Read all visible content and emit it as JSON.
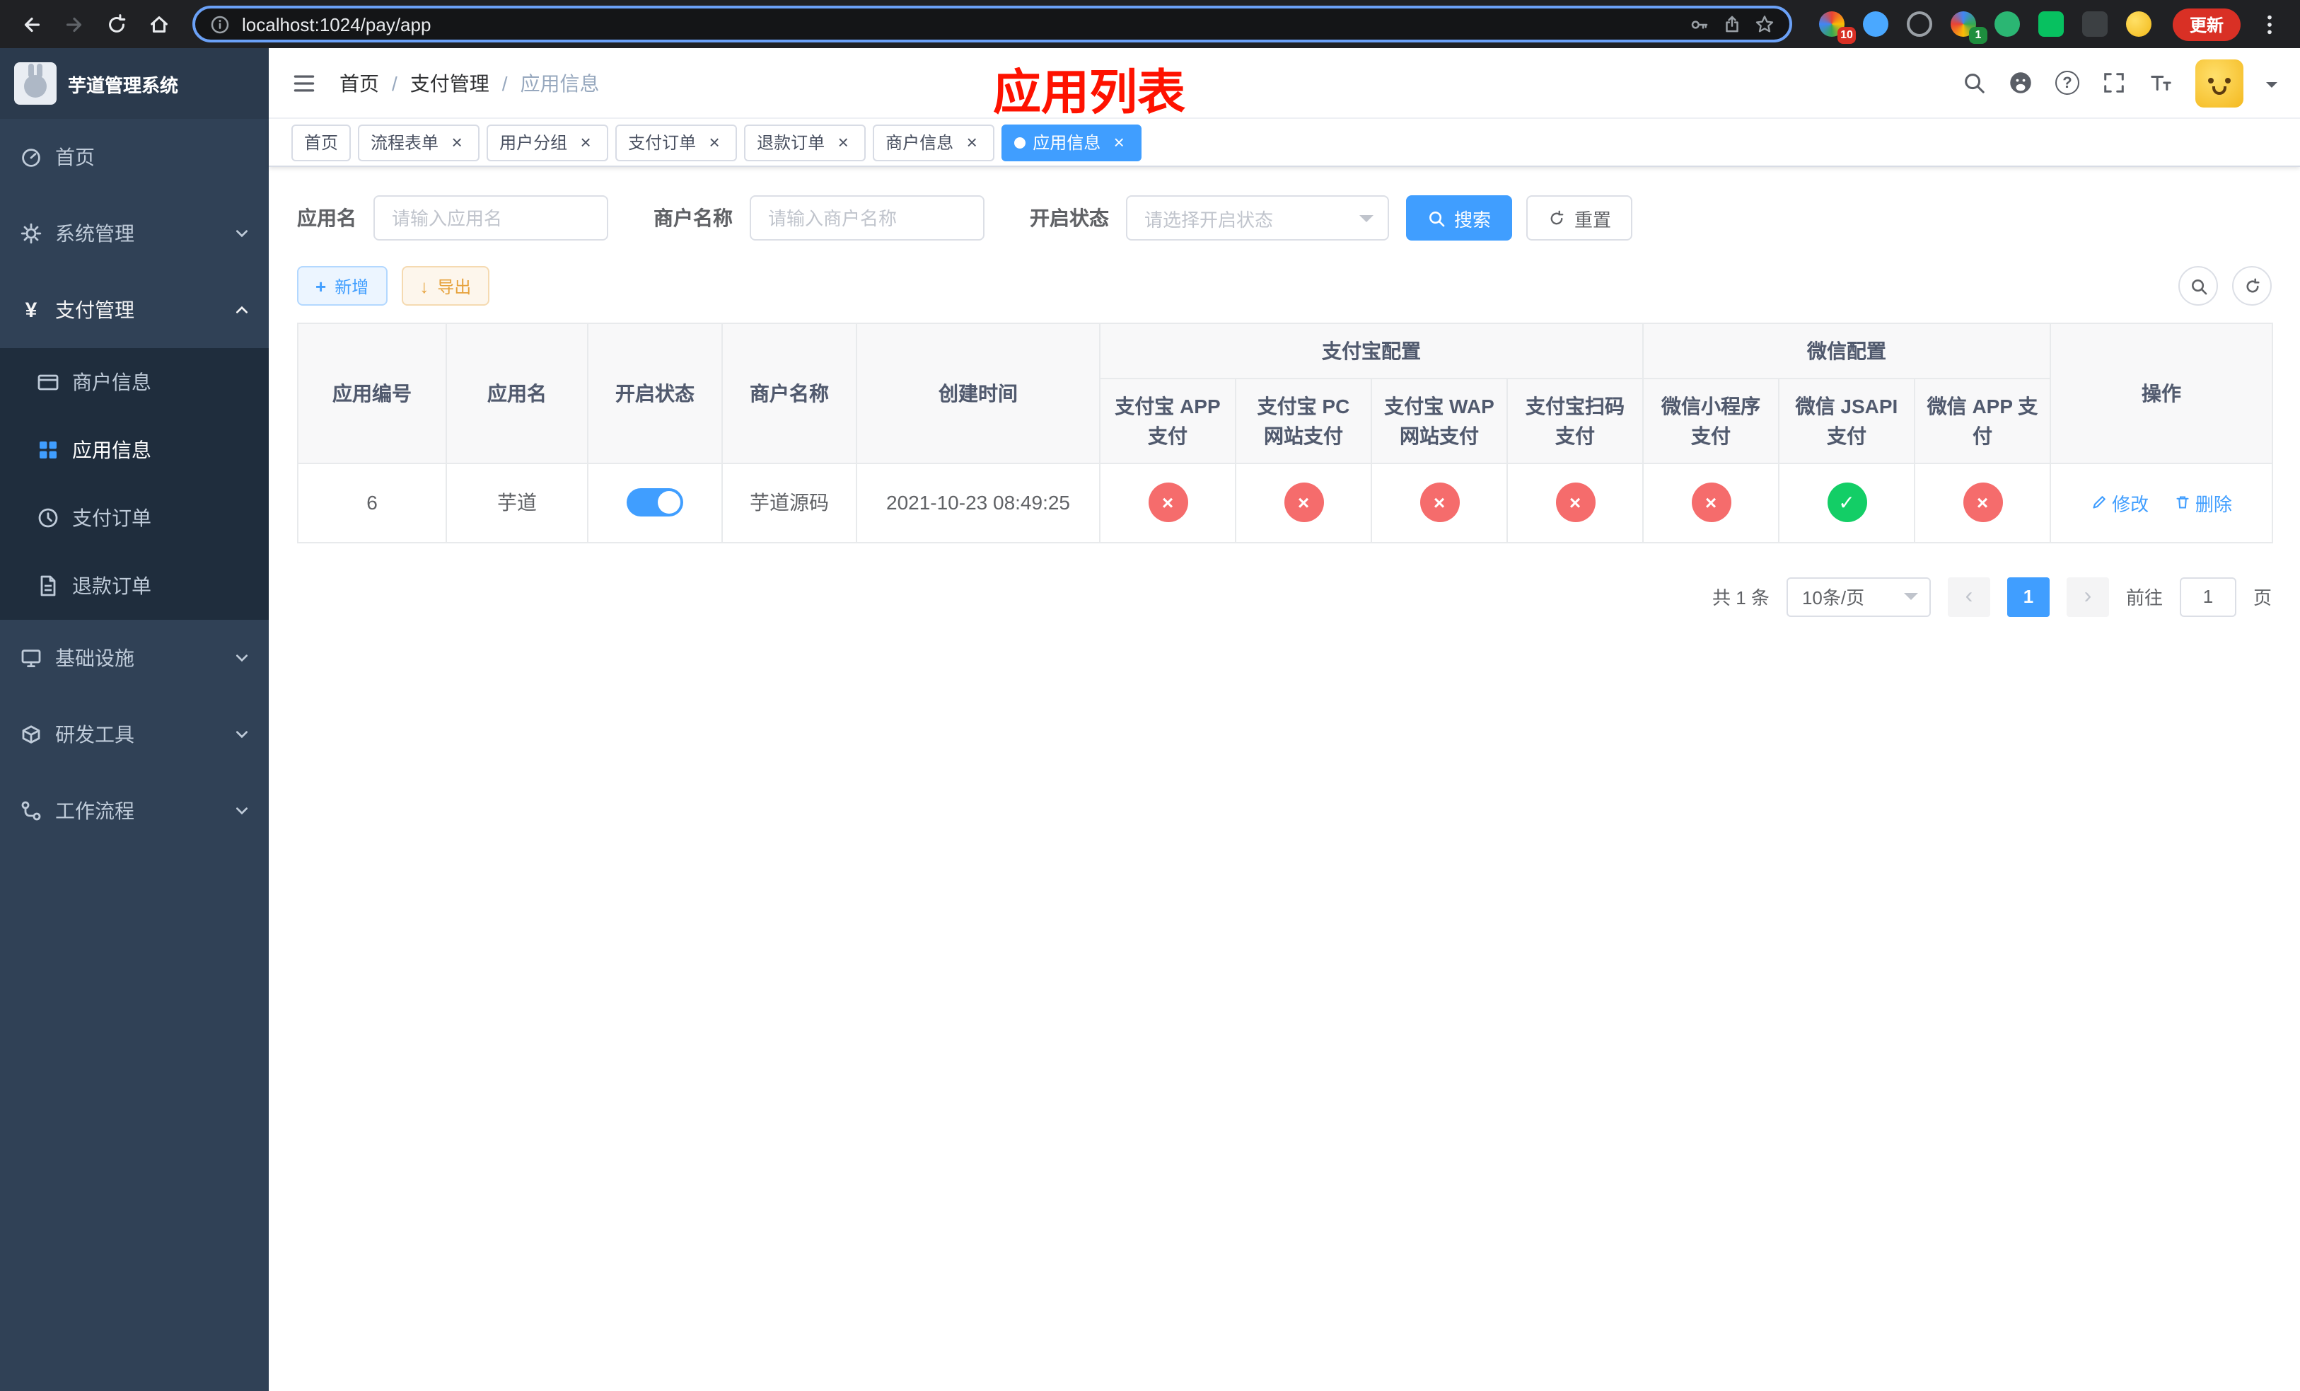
{
  "browser": {
    "url": "localhost:1024/pay/app",
    "update_label": "更新",
    "ext_badge_a": "10",
    "ext_badge_b": "1"
  },
  "icons": {
    "close": "×",
    "plus": "+",
    "check": "✓",
    "cross": "×",
    "yen": "¥",
    "help": "?",
    "prev": "‹",
    "next": "›",
    "download": "↓"
  },
  "sidebar": {
    "title": "芋道管理系统",
    "items": [
      {
        "label": "首页"
      },
      {
        "label": "系统管理"
      },
      {
        "label": "支付管理",
        "children": [
          {
            "label": "商户信息"
          },
          {
            "label": "应用信息"
          },
          {
            "label": "支付订单"
          },
          {
            "label": "退款订单"
          }
        ]
      },
      {
        "label": "基础设施"
      },
      {
        "label": "研发工具"
      },
      {
        "label": "工作流程"
      }
    ]
  },
  "navbar": {
    "breadcrumb": [
      "首页",
      "支付管理",
      "应用信息"
    ],
    "separator": "/"
  },
  "annotation": "应用列表",
  "tabs": [
    {
      "label": "首页"
    },
    {
      "label": "流程表单"
    },
    {
      "label": "用户分组"
    },
    {
      "label": "支付订单"
    },
    {
      "label": "退款订单"
    },
    {
      "label": "商户信息"
    },
    {
      "label": "应用信息"
    }
  ],
  "filters": {
    "app_name_label": "应用名",
    "app_name_placeholder": "请输入应用名",
    "merchant_label": "商户名称",
    "merchant_placeholder": "请输入商户名称",
    "status_label": "开启状态",
    "status_placeholder": "请选择开启状态",
    "search_label": "搜索",
    "reset_label": "重置"
  },
  "toolbar": {
    "add_label": "新增",
    "export_label": "导出"
  },
  "table": {
    "group_headers": {
      "alipay": "支付宝配置",
      "wechat": "微信配置"
    },
    "columns": [
      "应用编号",
      "应用名",
      "开启状态",
      "商户名称",
      "创建时间",
      "支付宝 APP 支付",
      "支付宝 PC 网站支付",
      "支付宝 WAP 网站支付",
      "支付宝扫码支付",
      "微信小程序支付",
      "微信 JSAPI 支付",
      "微信 APP 支付",
      "操作"
    ],
    "rows": [
      {
        "id": "6",
        "name": "芋道",
        "enabled": true,
        "merchant": "芋道源码",
        "created": "2021-10-23 08:49:25",
        "alipay_app": false,
        "alipay_pc": false,
        "alipay_wap": false,
        "alipay_qr": false,
        "wx_mini": false,
        "wx_jsapi": true,
        "wx_app": false,
        "edit_label": "修改",
        "delete_label": "删除"
      }
    ]
  },
  "pagination": {
    "total_text": "共 1 条",
    "page_size": "10条/页",
    "current_page": "1",
    "goto_prefix": "前往",
    "goto_value": "1",
    "goto_suffix": "页"
  },
  "colors": {
    "primary": "#409EFF",
    "success": "#13ce66",
    "danger": "#f56c6c",
    "warning": "#e6a23c"
  }
}
